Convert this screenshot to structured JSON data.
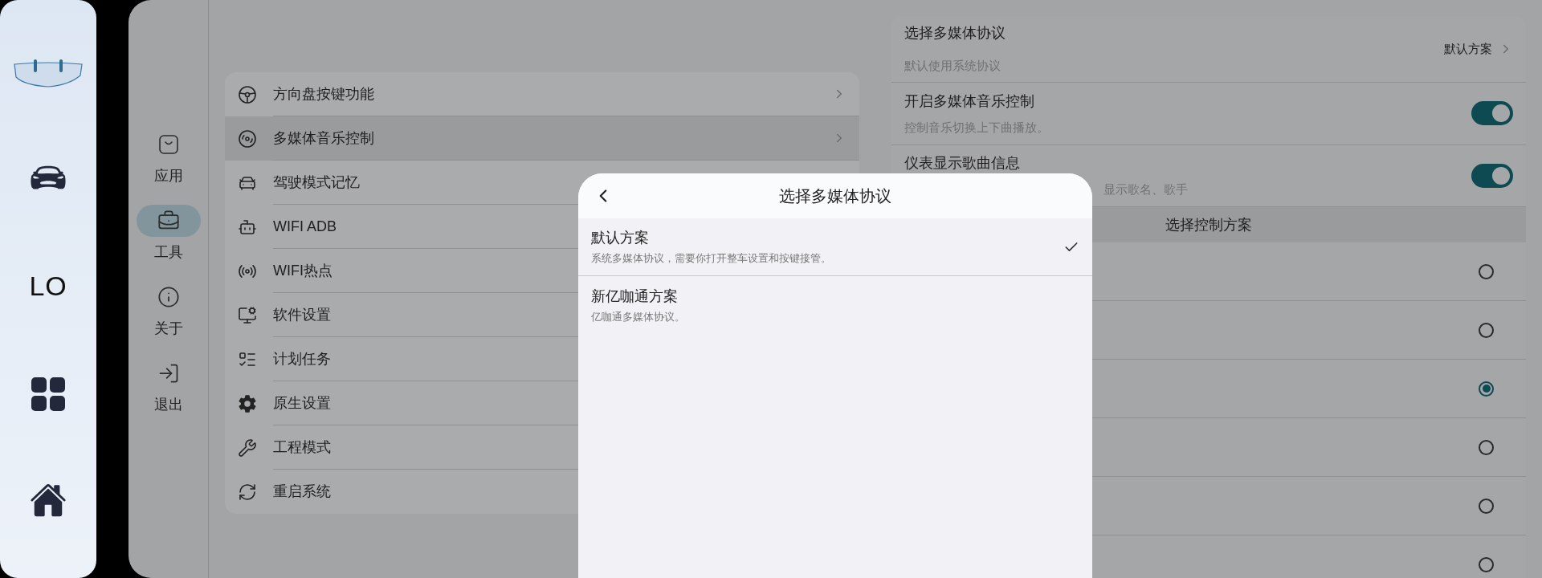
{
  "rail": {
    "items": [
      {
        "kind": "logo"
      },
      {
        "kind": "car"
      },
      {
        "kind": "text",
        "label": "LO"
      },
      {
        "kind": "grid"
      },
      {
        "kind": "home"
      }
    ]
  },
  "nav": {
    "items": [
      {
        "kind": "apps",
        "label": "应用",
        "selected": false
      },
      {
        "kind": "tools",
        "label": "工具",
        "selected": true
      },
      {
        "kind": "info",
        "label": "关于",
        "selected": false
      },
      {
        "kind": "exit",
        "label": "退出",
        "selected": false
      }
    ]
  },
  "menu": {
    "items": [
      {
        "kind": "steering",
        "label": "方向盘按键功能",
        "selected": false
      },
      {
        "kind": "disc",
        "label": "多媒体音乐控制",
        "selected": true
      },
      {
        "kind": "car",
        "label": "驾驶模式记忆",
        "selected": false
      },
      {
        "kind": "android",
        "label": "WIFI ADB",
        "selected": false
      },
      {
        "kind": "hotspot",
        "label": "WIFI热点",
        "selected": false
      },
      {
        "kind": "monitor",
        "label": "软件设置",
        "selected": false
      },
      {
        "kind": "checklist",
        "label": "计划任务",
        "selected": false
      },
      {
        "kind": "gear",
        "label": "原生设置",
        "selected": false
      },
      {
        "kind": "wrench",
        "label": "工程模式",
        "selected": false
      },
      {
        "kind": "restart",
        "label": "重启系统",
        "selected": false
      }
    ]
  },
  "settings": {
    "protocol": {
      "title": "选择多媒体协议",
      "subtitle": "默认使用系统协议",
      "value": "默认方案"
    },
    "toggles": [
      {
        "title": "开启多媒体音乐控制",
        "subtitle": "控制音乐切换上下曲播放。",
        "on": true
      },
      {
        "title": "仪表显示歌曲信息",
        "subtitle": "显示歌名、歌手",
        "on": true
      }
    ],
    "section_title": "选择控制方案",
    "options": [
      {
        "selected": false
      },
      {
        "selected": false
      },
      {
        "selected": true
      },
      {
        "selected": false
      },
      {
        "selected": false
      },
      {
        "selected": false
      }
    ]
  },
  "dialog": {
    "title": "选择多媒体协议",
    "options": [
      {
        "title": "默认方案",
        "subtitle": "系统多媒体协议，需要你打开整车设置和按键接管。",
        "selected": true
      },
      {
        "title": "新亿咖通方案",
        "subtitle": "亿咖通多媒体协议。",
        "selected": false
      }
    ]
  }
}
